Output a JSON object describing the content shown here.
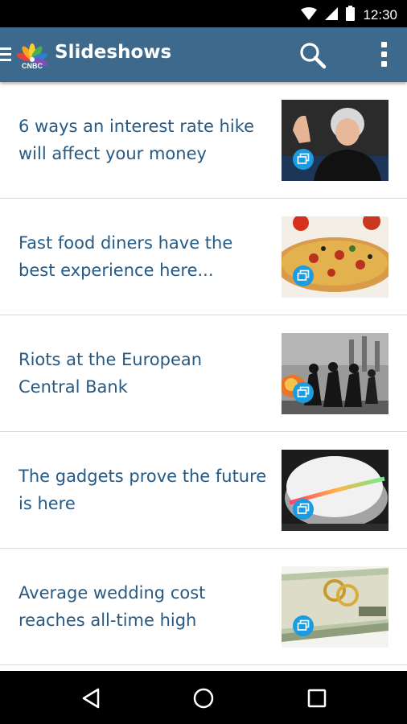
{
  "status_bar": {
    "time": "12:30"
  },
  "app_bar": {
    "title": "Slideshows",
    "logo_text": "CNBC"
  },
  "slideshows": [
    {
      "title": "6 ways an interest rate hike will affect your money"
    },
    {
      "title": "Fast food diners have the best experience here..."
    },
    {
      "title": "Riots at the European Central Bank"
    },
    {
      "title": "The gadgets prove the future is here"
    },
    {
      "title": "Average wedding cost reaches all-time high"
    }
  ],
  "colors": {
    "app_bar": "#3d6a8c",
    "title_text": "#265a85",
    "badge": "#1b9ce0",
    "divider": "#d9d9d9"
  },
  "icons": [
    "wifi-icon",
    "cell-signal-icon",
    "battery-icon",
    "menu-icon",
    "search-icon",
    "overflow-menu-icon",
    "slideshow-badge-icon",
    "nav-back-icon",
    "nav-home-icon",
    "nav-recent-icon"
  ]
}
